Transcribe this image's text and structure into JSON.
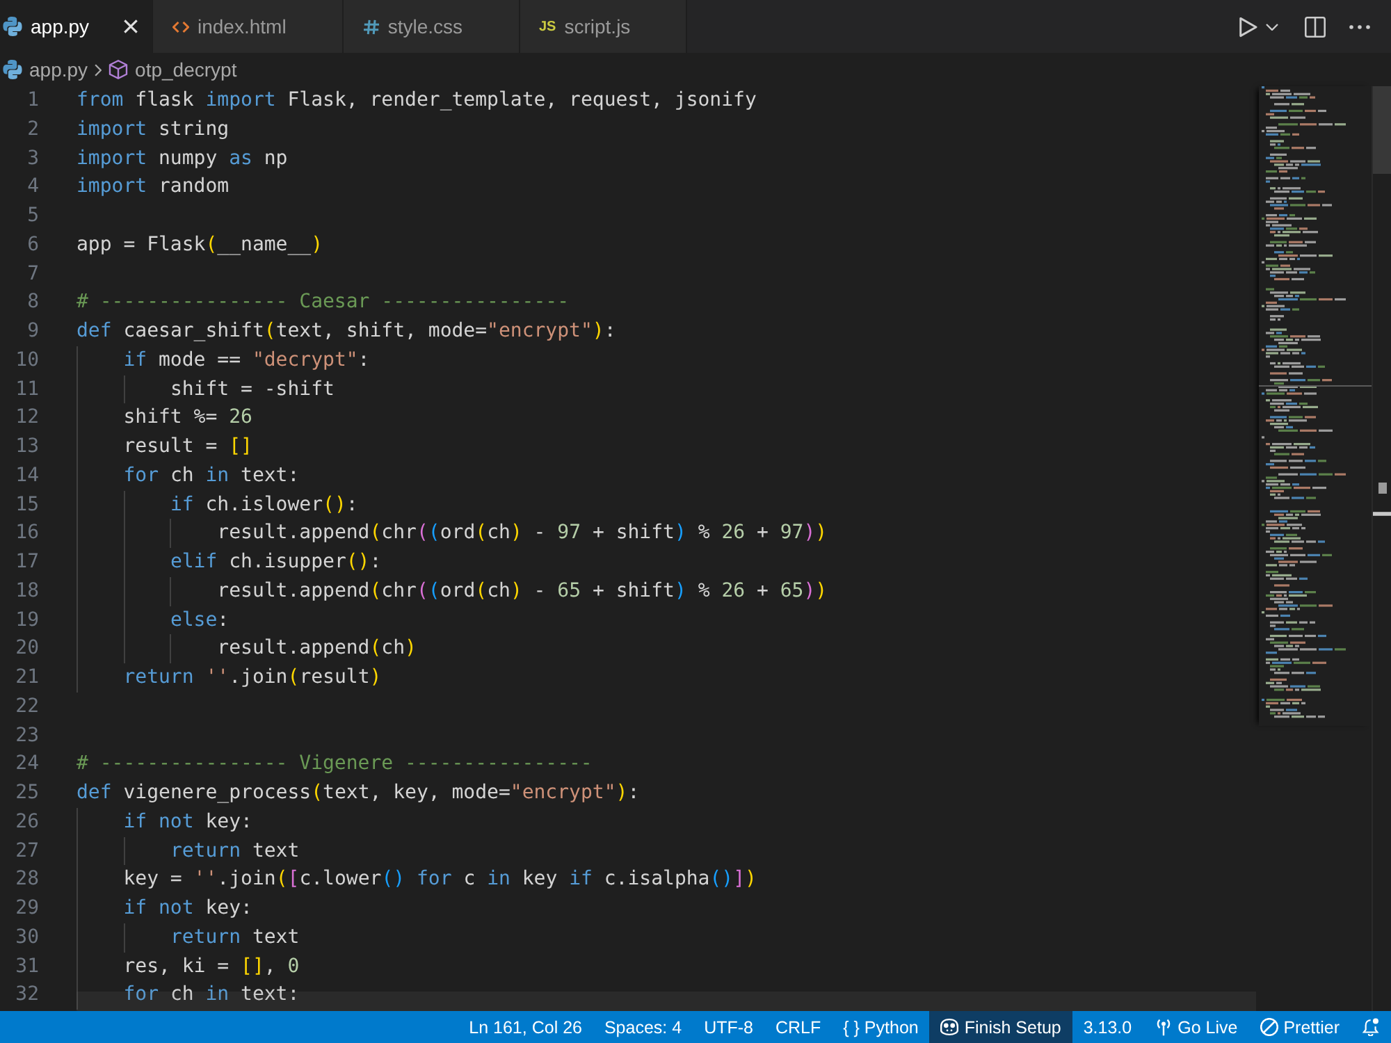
{
  "tabs": [
    {
      "label": "app.py",
      "kind": "python",
      "selected": true
    },
    {
      "label": "index.html",
      "kind": "html",
      "selected": false
    },
    {
      "label": "style.css",
      "kind": "css",
      "selected": false
    },
    {
      "label": "script.js",
      "kind": "js",
      "icon_text": "JS",
      "selected": false
    }
  ],
  "breadcrumb": [
    {
      "kind": "python",
      "label": "app.py"
    },
    {
      "kind": "method",
      "label": "otp_decrypt"
    }
  ],
  "editor": {
    "lines": [
      {
        "number": "1",
        "tokens": [
          {
            "kind": "keyword",
            "text": "from"
          },
          {
            "kind": "text",
            "text": " flask "
          },
          {
            "kind": "keyword",
            "text": "import"
          },
          {
            "kind": "text",
            "text": " Flask, render_template, request, jsonify"
          }
        ]
      },
      {
        "number": "2",
        "tokens": [
          {
            "kind": "keyword",
            "text": "import"
          },
          {
            "kind": "text",
            "text": " string"
          }
        ]
      },
      {
        "number": "3",
        "tokens": [
          {
            "kind": "keyword",
            "text": "import"
          },
          {
            "kind": "text",
            "text": " numpy "
          },
          {
            "kind": "keyword",
            "text": "as"
          },
          {
            "kind": "text",
            "text": " np"
          }
        ]
      },
      {
        "number": "4",
        "tokens": [
          {
            "kind": "keyword",
            "text": "import"
          },
          {
            "kind": "text",
            "text": " random"
          }
        ]
      },
      {
        "number": "5"
      },
      {
        "number": "6",
        "tokens": [
          {
            "kind": "text",
            "text": "app = Flask"
          },
          {
            "kind": "bracket1",
            "text": "("
          },
          {
            "kind": "text",
            "text": "__name__"
          },
          {
            "kind": "bracket1",
            "text": ")"
          }
        ]
      },
      {
        "number": "7"
      },
      {
        "number": "8",
        "tokens": [
          {
            "kind": "comment",
            "text": "# ---------------- Caesar ----------------"
          }
        ]
      },
      {
        "number": "9",
        "tokens": [
          {
            "kind": "keyword",
            "text": "def"
          },
          {
            "kind": "text",
            "text": " caesar_shift"
          },
          {
            "kind": "bracket1",
            "text": "("
          },
          {
            "kind": "text",
            "text": "text, shift, mode="
          },
          {
            "kind": "string",
            "text": "\"encrypt\""
          },
          {
            "kind": "bracket1",
            "text": ")"
          },
          {
            "kind": "text",
            "text": ":"
          }
        ]
      },
      {
        "number": "10",
        "tokens": [
          {
            "kind": "keyword",
            "text": "    if"
          },
          {
            "kind": "text",
            "text": " mode == "
          },
          {
            "kind": "string",
            "text": "\"decrypt\""
          },
          {
            "kind": "text",
            "text": ":"
          }
        ]
      },
      {
        "number": "11",
        "tokens": [
          {
            "kind": "text",
            "text": "        shift = -shift"
          }
        ]
      },
      {
        "number": "12",
        "tokens": [
          {
            "kind": "text",
            "text": "    shift %= "
          },
          {
            "kind": "number",
            "text": "26"
          }
        ]
      },
      {
        "number": "13",
        "tokens": [
          {
            "kind": "text",
            "text": "    result = "
          },
          {
            "kind": "bracket1",
            "text": "[]"
          }
        ]
      },
      {
        "number": "14",
        "tokens": [
          {
            "kind": "keyword",
            "text": "    for"
          },
          {
            "kind": "text",
            "text": " ch "
          },
          {
            "kind": "keyword",
            "text": "in"
          },
          {
            "kind": "text",
            "text": " text:"
          }
        ]
      },
      {
        "number": "15",
        "tokens": [
          {
            "kind": "keyword",
            "text": "        if"
          },
          {
            "kind": "text",
            "text": " ch.islower"
          },
          {
            "kind": "bracket1",
            "text": "()"
          },
          {
            "kind": "text",
            "text": ":"
          }
        ]
      },
      {
        "number": "16",
        "tokens": [
          {
            "kind": "text",
            "text": "            result.append"
          },
          {
            "kind": "bracket1",
            "text": "("
          },
          {
            "kind": "text",
            "text": "chr"
          },
          {
            "kind": "bracket2",
            "text": "("
          },
          {
            "kind": "bracket3",
            "text": "("
          },
          {
            "kind": "text",
            "text": "ord"
          },
          {
            "kind": "bracket1",
            "text": "("
          },
          {
            "kind": "text",
            "text": "ch"
          },
          {
            "kind": "bracket1",
            "text": ")"
          },
          {
            "kind": "text",
            "text": " - "
          },
          {
            "kind": "number",
            "text": "97"
          },
          {
            "kind": "text",
            "text": " + shift"
          },
          {
            "kind": "bracket3",
            "text": ")"
          },
          {
            "kind": "text",
            "text": " % "
          },
          {
            "kind": "number",
            "text": "26"
          },
          {
            "kind": "text",
            "text": " + "
          },
          {
            "kind": "number",
            "text": "97"
          },
          {
            "kind": "bracket2",
            "text": ")"
          },
          {
            "kind": "bracket1",
            "text": ")"
          }
        ]
      },
      {
        "number": "17",
        "tokens": [
          {
            "kind": "keyword",
            "text": "        elif"
          },
          {
            "kind": "text",
            "text": " ch.isupper"
          },
          {
            "kind": "bracket1",
            "text": "()"
          },
          {
            "kind": "text",
            "text": ":"
          }
        ]
      },
      {
        "number": "18",
        "tokens": [
          {
            "kind": "text",
            "text": "            result.append"
          },
          {
            "kind": "bracket1",
            "text": "("
          },
          {
            "kind": "text",
            "text": "chr"
          },
          {
            "kind": "bracket2",
            "text": "("
          },
          {
            "kind": "bracket3",
            "text": "("
          },
          {
            "kind": "text",
            "text": "ord"
          },
          {
            "kind": "bracket1",
            "text": "("
          },
          {
            "kind": "text",
            "text": "ch"
          },
          {
            "kind": "bracket1",
            "text": ")"
          },
          {
            "kind": "text",
            "text": " - "
          },
          {
            "kind": "number",
            "text": "65"
          },
          {
            "kind": "text",
            "text": " + shift"
          },
          {
            "kind": "bracket3",
            "text": ")"
          },
          {
            "kind": "text",
            "text": " % "
          },
          {
            "kind": "number",
            "text": "26"
          },
          {
            "kind": "text",
            "text": " + "
          },
          {
            "kind": "number",
            "text": "65"
          },
          {
            "kind": "bracket2",
            "text": ")"
          },
          {
            "kind": "bracket1",
            "text": ")"
          }
        ]
      },
      {
        "number": "19",
        "tokens": [
          {
            "kind": "keyword",
            "text": "        else"
          },
          {
            "kind": "text",
            "text": ":"
          }
        ]
      },
      {
        "number": "20",
        "tokens": [
          {
            "kind": "text",
            "text": "            result.append"
          },
          {
            "kind": "bracket1",
            "text": "("
          },
          {
            "kind": "text",
            "text": "ch"
          },
          {
            "kind": "bracket1",
            "text": ")"
          }
        ]
      },
      {
        "number": "21",
        "tokens": [
          {
            "kind": "keyword",
            "text": "    return"
          },
          {
            "kind": "string",
            "text": " ''"
          },
          {
            "kind": "text",
            "text": ".join"
          },
          {
            "kind": "bracket1",
            "text": "("
          },
          {
            "kind": "text",
            "text": "result"
          },
          {
            "kind": "bracket1",
            "text": ")"
          }
        ]
      },
      {
        "number": "22"
      },
      {
        "number": "23"
      },
      {
        "number": "24",
        "tokens": [
          {
            "kind": "comment",
            "text": "# ---------------- Vigenere ----------------"
          }
        ]
      },
      {
        "number": "25",
        "tokens": [
          {
            "kind": "keyword",
            "text": "def"
          },
          {
            "kind": "text",
            "text": " vigenere_process"
          },
          {
            "kind": "bracket1",
            "text": "("
          },
          {
            "kind": "text",
            "text": "text, key, mode="
          },
          {
            "kind": "string",
            "text": "\"encrypt\""
          },
          {
            "kind": "bracket1",
            "text": ")"
          },
          {
            "kind": "text",
            "text": ":"
          }
        ]
      },
      {
        "number": "26",
        "tokens": [
          {
            "kind": "keyword",
            "text": "    if not"
          },
          {
            "kind": "text",
            "text": " key:"
          }
        ]
      },
      {
        "number": "27",
        "tokens": [
          {
            "kind": "keyword",
            "text": "        return"
          },
          {
            "kind": "text",
            "text": " text"
          }
        ]
      },
      {
        "number": "28",
        "tokens": [
          {
            "kind": "text",
            "text": "    key = "
          },
          {
            "kind": "string",
            "text": "''"
          },
          {
            "kind": "text",
            "text": ".join"
          },
          {
            "kind": "bracket1",
            "text": "("
          },
          {
            "kind": "bracket2",
            "text": "["
          },
          {
            "kind": "text",
            "text": "c.lower"
          },
          {
            "kind": "bracket3",
            "text": "()"
          },
          {
            "kind": "keyword",
            "text": " for"
          },
          {
            "kind": "text",
            "text": " c "
          },
          {
            "kind": "keyword",
            "text": "in"
          },
          {
            "kind": "text",
            "text": " key "
          },
          {
            "kind": "keyword",
            "text": "if"
          },
          {
            "kind": "text",
            "text": " c.isalpha"
          },
          {
            "kind": "bracket3",
            "text": "()"
          },
          {
            "kind": "bracket2",
            "text": "]"
          },
          {
            "kind": "bracket1",
            "text": ")"
          }
        ]
      },
      {
        "number": "29",
        "tokens": [
          {
            "kind": "keyword",
            "text": "    if not"
          },
          {
            "kind": "text",
            "text": " key:"
          }
        ]
      },
      {
        "number": "30",
        "tokens": [
          {
            "kind": "keyword",
            "text": "        return"
          },
          {
            "kind": "text",
            "text": " text"
          }
        ]
      },
      {
        "number": "31",
        "tokens": [
          {
            "kind": "text",
            "text": "    res, ki = "
          },
          {
            "kind": "bracket1",
            "text": "[]"
          },
          {
            "kind": "text",
            "text": ", "
          },
          {
            "kind": "number",
            "text": "0"
          }
        ]
      },
      {
        "number": "32",
        "tokens": [
          {
            "kind": "keyword",
            "text": "    for"
          },
          {
            "kind": "text",
            "text": " ch "
          },
          {
            "kind": "keyword",
            "text": "in"
          },
          {
            "kind": "text",
            "text": " text:"
          }
        ]
      }
    ]
  },
  "status_bar": {
    "items": [
      {
        "kind": "text",
        "label": "Ln 161, Col 26"
      },
      {
        "kind": "text",
        "label": "Spaces: 4"
      },
      {
        "kind": "text",
        "label": "UTF-8"
      },
      {
        "kind": "text",
        "label": "CRLF"
      },
      {
        "kind": "text",
        "label": "{ } Python"
      },
      {
        "kind": "copilot",
        "label": "Finish Setup"
      },
      {
        "kind": "text",
        "label": "3.13.0"
      },
      {
        "kind": "broadcast",
        "label": "Go Live"
      },
      {
        "kind": "prettier",
        "label": "Prettier"
      },
      {
        "kind": "bell"
      }
    ]
  }
}
